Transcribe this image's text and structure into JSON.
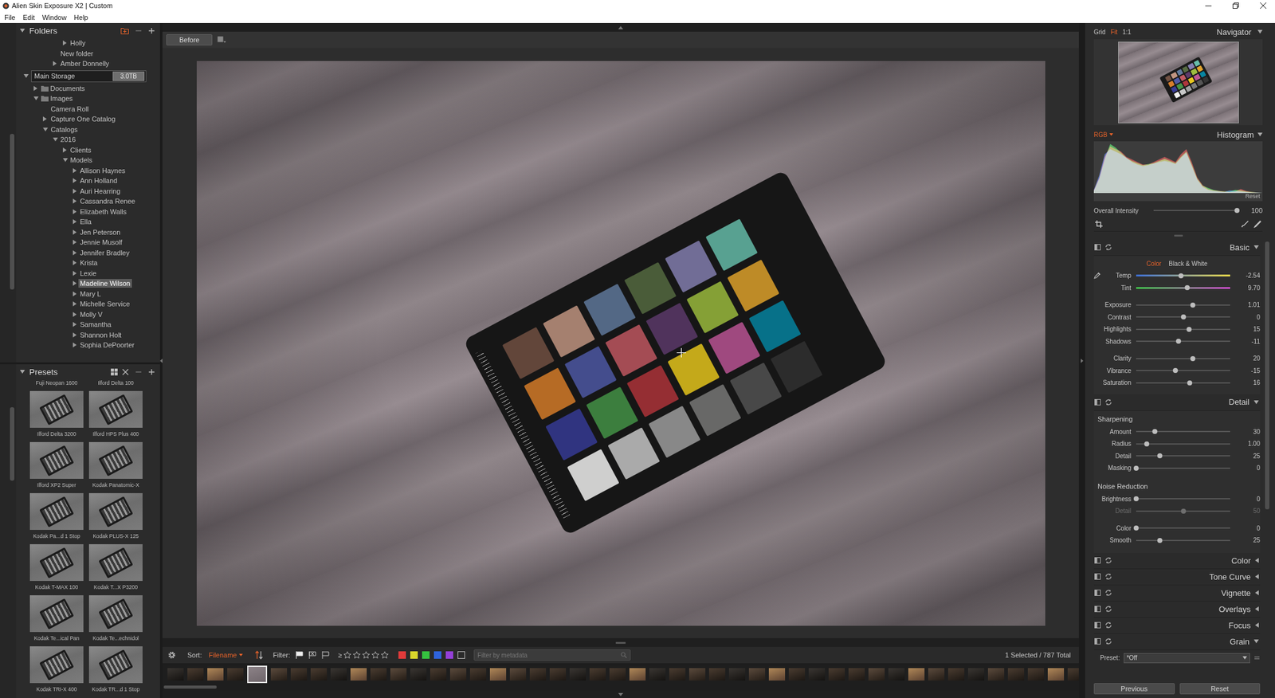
{
  "window": {
    "title": "Alien Skin Exposure X2 | Custom"
  },
  "menu": [
    "File",
    "Edit",
    "Window",
    "Help"
  ],
  "folders": {
    "title": "Folders",
    "items": [
      {
        "label": "Holly",
        "depth": 4,
        "kind": "plain",
        "has_children": true,
        "expanded": false,
        "selected": false
      },
      {
        "label": "New folder",
        "depth": 3,
        "kind": "plain",
        "has_children": false,
        "expanded": false,
        "selected": false
      },
      {
        "label": "Amber Donnelly",
        "depth": 3,
        "kind": "plain",
        "has_children": true,
        "expanded": false,
        "selected": false
      },
      {
        "label": "Main Storage",
        "depth": 0,
        "kind": "drive",
        "badge": "3.0TB",
        "has_children": true,
        "expanded": true,
        "selected": false
      },
      {
        "label": "Documents",
        "depth": 1,
        "kind": "folder",
        "has_children": true,
        "expanded": false,
        "selected": false
      },
      {
        "label": "Images",
        "depth": 1,
        "kind": "folder",
        "has_children": true,
        "expanded": true,
        "selected": false
      },
      {
        "label": "Camera Roll",
        "depth": 2,
        "kind": "plain",
        "has_children": false,
        "expanded": false,
        "selected": false
      },
      {
        "label": "Capture One Catalog",
        "depth": 2,
        "kind": "plain",
        "has_children": true,
        "expanded": false,
        "selected": false
      },
      {
        "label": "Catalogs",
        "depth": 2,
        "kind": "plain",
        "has_children": true,
        "expanded": true,
        "selected": false
      },
      {
        "label": "2016",
        "depth": 3,
        "kind": "plain",
        "has_children": true,
        "expanded": true,
        "selected": false
      },
      {
        "label": "Clients",
        "depth": 4,
        "kind": "plain",
        "has_children": true,
        "expanded": false,
        "selected": false
      },
      {
        "label": "Models",
        "depth": 4,
        "kind": "plain",
        "has_children": true,
        "expanded": true,
        "selected": false
      },
      {
        "label": "Allison Haynes",
        "depth": 5,
        "kind": "plain",
        "has_children": true,
        "expanded": false,
        "selected": false
      },
      {
        "label": "Ann Holland",
        "depth": 5,
        "kind": "plain",
        "has_children": true,
        "expanded": false,
        "selected": false
      },
      {
        "label": "Auri Hearring",
        "depth": 5,
        "kind": "plain",
        "has_children": true,
        "expanded": false,
        "selected": false
      },
      {
        "label": "Cassandra Renee",
        "depth": 5,
        "kind": "plain",
        "has_children": true,
        "expanded": false,
        "selected": false
      },
      {
        "label": "Elizabeth Walls",
        "depth": 5,
        "kind": "plain",
        "has_children": true,
        "expanded": false,
        "selected": false
      },
      {
        "label": "Ella",
        "depth": 5,
        "kind": "plain",
        "has_children": true,
        "expanded": false,
        "selected": false
      },
      {
        "label": "Jen Peterson",
        "depth": 5,
        "kind": "plain",
        "has_children": true,
        "expanded": false,
        "selected": false
      },
      {
        "label": "Jennie Musolf",
        "depth": 5,
        "kind": "plain",
        "has_children": true,
        "expanded": false,
        "selected": false
      },
      {
        "label": "Jennifer Bradley",
        "depth": 5,
        "kind": "plain",
        "has_children": true,
        "expanded": false,
        "selected": false
      },
      {
        "label": "Krista",
        "depth": 5,
        "kind": "plain",
        "has_children": true,
        "expanded": false,
        "selected": false
      },
      {
        "label": "Lexie",
        "depth": 5,
        "kind": "plain",
        "has_children": true,
        "expanded": false,
        "selected": false
      },
      {
        "label": "Madeline Wilson",
        "depth": 5,
        "kind": "plain",
        "has_children": true,
        "expanded": false,
        "selected": true
      },
      {
        "label": "Mary L",
        "depth": 5,
        "kind": "plain",
        "has_children": true,
        "expanded": false,
        "selected": false
      },
      {
        "label": "Michelle Service",
        "depth": 5,
        "kind": "plain",
        "has_children": true,
        "expanded": false,
        "selected": false
      },
      {
        "label": "Molly V",
        "depth": 5,
        "kind": "plain",
        "has_children": true,
        "expanded": false,
        "selected": false
      },
      {
        "label": "Samantha",
        "depth": 5,
        "kind": "plain",
        "has_children": true,
        "expanded": false,
        "selected": false
      },
      {
        "label": "Shannon Holt",
        "depth": 5,
        "kind": "plain",
        "has_children": true,
        "expanded": false,
        "selected": false
      },
      {
        "label": "Sophia DePoorter",
        "depth": 5,
        "kind": "plain",
        "has_children": true,
        "expanded": false,
        "selected": false
      }
    ]
  },
  "presets": {
    "title": "Presets",
    "items": [
      "Fuji Neopan 1600",
      "Ilford Delta 100",
      "Ilford Delta 3200",
      "Ilford HPS Plus 400",
      "Ilford XP2 Super",
      "Kodak Panatomic-X",
      "Kodak Pa...d 1 Stop",
      "Kodak PLUS-X 125",
      "Kodak T-MAX 100",
      "Kodak T...X P3200",
      "Kodak Te...ical Pan",
      "Kodak Te...echnidol",
      "Kodak TRI-X 400",
      "Kodak TR...d 1 Stop"
    ]
  },
  "toolbar": {
    "before_button": "Before"
  },
  "filter_bar": {
    "sort_label": "Sort:",
    "sort_value": "Filename",
    "filter_label": "Filter:",
    "rating": {
      "operator": "≥",
      "stars": 0,
      "max": 5
    },
    "color_labels": [
      {
        "kind": "swatch",
        "color": "#e03a3a",
        "selected": false
      },
      {
        "kind": "swatch",
        "color": "#d8d52c",
        "selected": false
      },
      {
        "kind": "swatch",
        "color": "#35c13f",
        "selected": false
      },
      {
        "kind": "swatch",
        "color": "#2f63dd",
        "selected": false
      },
      {
        "kind": "swatch",
        "color": "#9440d8",
        "selected": false
      },
      {
        "kind": "none",
        "color": "#000000",
        "selected": false
      }
    ],
    "search_placeholder": "Filter by metadata",
    "status": "1 Selected / 787 Total"
  },
  "filmstrip": [
    {
      "selected": false
    },
    {
      "selected": false
    },
    {
      "selected": false
    },
    {
      "selected": false
    },
    {
      "selected": true
    },
    {
      "selected": false
    },
    {
      "selected": false
    },
    {
      "selected": false
    },
    {
      "selected": false
    },
    {
      "selected": false
    },
    {
      "selected": false
    },
    {
      "selected": false
    },
    {
      "selected": false
    },
    {
      "selected": false
    },
    {
      "selected": false
    },
    {
      "selected": false
    },
    {
      "selected": false
    },
    {
      "selected": false
    },
    {
      "selected": false
    },
    {
      "selected": false
    },
    {
      "selected": false
    },
    {
      "selected": false
    },
    {
      "selected": false
    },
    {
      "selected": false
    },
    {
      "selected": false
    },
    {
      "selected": false
    },
    {
      "selected": false
    },
    {
      "selected": false
    },
    {
      "selected": false
    },
    {
      "selected": false
    },
    {
      "selected": false
    },
    {
      "selected": false
    },
    {
      "selected": false
    },
    {
      "selected": false
    },
    {
      "selected": false
    },
    {
      "selected": false
    },
    {
      "selected": false
    },
    {
      "selected": false
    },
    {
      "selected": false
    },
    {
      "selected": false
    },
    {
      "selected": false
    },
    {
      "selected": false
    },
    {
      "selected": false
    },
    {
      "selected": false
    },
    {
      "selected": false
    },
    {
      "selected": false
    }
  ],
  "navigator": {
    "title": "Navigator",
    "zoom_modes": [
      {
        "label": "Grid",
        "selected": false
      },
      {
        "label": "Fit",
        "selected": true
      },
      {
        "label": "1:1",
        "selected": false
      }
    ]
  },
  "histogram": {
    "title": "Histogram",
    "channel": "RGB",
    "reset": "Reset",
    "series": [
      {
        "name": "red",
        "color": "#ff3b3b",
        "values": [
          5,
          30,
          70,
          90,
          85,
          80,
          70,
          65,
          60,
          55,
          55,
          60,
          65,
          70,
          65,
          60,
          75,
          85,
          60,
          30,
          15,
          8,
          5,
          4,
          3,
          2,
          3,
          8,
          4,
          2,
          1,
          0
        ]
      },
      {
        "name": "green",
        "color": "#3bff5a",
        "values": [
          4,
          28,
          65,
          95,
          88,
          78,
          68,
          62,
          58,
          54,
          56,
          58,
          62,
          66,
          62,
          58,
          70,
          80,
          55,
          28,
          14,
          10,
          6,
          4,
          3,
          3,
          6,
          5,
          3,
          2,
          1,
          0
        ]
      },
      {
        "name": "blue",
        "color": "#3b7bff",
        "values": [
          6,
          35,
          75,
          85,
          80,
          75,
          68,
          60,
          55,
          52,
          54,
          57,
          60,
          62,
          60,
          56,
          68,
          78,
          52,
          26,
          12,
          6,
          4,
          3,
          2,
          5,
          4,
          3,
          2,
          1,
          1,
          0
        ]
      }
    ],
    "intensity": {
      "label": "Overall Intensity",
      "level": 0.98,
      "reading": "100"
    }
  },
  "basic": {
    "title": "Basic",
    "expanded": true,
    "modes": [
      {
        "label": "Color",
        "selected": true
      },
      {
        "label": "Black & White",
        "selected": false
      }
    ],
    "rows": [
      [
        {
          "label": "Temp",
          "kind": "temp",
          "level": 0.48,
          "reading": "-2.54",
          "disabled": false
        },
        {
          "label": "Tint",
          "kind": "tint",
          "level": 0.54,
          "reading": "9.70",
          "disabled": false
        }
      ],
      [
        {
          "label": "Exposure",
          "kind": "plain",
          "level": 0.6,
          "reading": "1.01",
          "disabled": false
        },
        {
          "label": "Contrast",
          "kind": "plain",
          "level": 0.5,
          "reading": "0",
          "disabled": false
        },
        {
          "label": "Highlights",
          "kind": "plain",
          "level": 0.56,
          "reading": "15",
          "disabled": false
        },
        {
          "label": "Shadows",
          "kind": "plain",
          "level": 0.45,
          "reading": "-11",
          "disabled": false
        }
      ],
      [
        {
          "label": "Clarity",
          "kind": "plain",
          "level": 0.6,
          "reading": "20",
          "disabled": false
        },
        {
          "label": "Vibrance",
          "kind": "plain",
          "level": 0.42,
          "reading": "-15",
          "disabled": false
        },
        {
          "label": "Saturation",
          "kind": "plain",
          "level": 0.57,
          "reading": "16",
          "disabled": false
        }
      ]
    ]
  },
  "detail": {
    "title": "Detail",
    "expanded": true,
    "groups": [
      {
        "title": "Sharpening",
        "rows": [
          [
            {
              "label": "Amount",
              "kind": "plain",
              "level": 0.2,
              "reading": "30",
              "disabled": false
            },
            {
              "label": "Radius",
              "kind": "plain",
              "level": 0.11,
              "reading": "1.00",
              "disabled": false
            },
            {
              "label": "Detail",
              "kind": "plain",
              "level": 0.25,
              "reading": "25",
              "disabled": false
            },
            {
              "label": "Masking",
              "kind": "plain",
              "level": 0,
              "reading": "0",
              "disabled": false
            }
          ]
        ]
      },
      {
        "title": "Noise Reduction",
        "rows": [
          [
            {
              "label": "Brightness",
              "kind": "plain",
              "level": 0,
              "reading": "0",
              "disabled": false
            },
            {
              "label": "Detail",
              "kind": "plain",
              "level": 0.5,
              "reading": "50",
              "disabled": true
            }
          ],
          [
            {
              "label": "Color",
              "kind": "plain",
              "level": 0,
              "reading": "0",
              "disabled": false
            },
            {
              "label": "Smooth",
              "kind": "plain",
              "level": 0.25,
              "reading": "25",
              "disabled": false
            }
          ]
        ]
      }
    ]
  },
  "sections": [
    {
      "title": "Color",
      "expanded": false
    },
    {
      "title": "Tone Curve",
      "expanded": false
    },
    {
      "title": "Vignette",
      "expanded": false
    },
    {
      "title": "Overlays",
      "expanded": false
    },
    {
      "title": "Focus",
      "expanded": false
    },
    {
      "title": "Grain",
      "expanded": true
    }
  ],
  "grain_preset": {
    "label": "Preset:",
    "value": "*Off"
  },
  "footer_buttons": [
    "Previous",
    "Reset"
  ]
}
